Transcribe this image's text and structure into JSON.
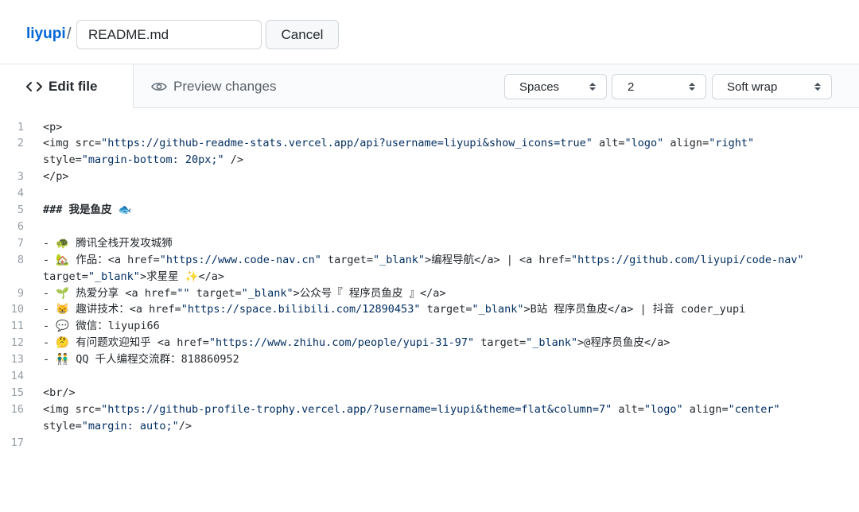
{
  "header": {
    "owner": "liyupi",
    "separator": "/",
    "filename": "README.md",
    "cancel_label": "Cancel"
  },
  "tabs": {
    "edit_label": "Edit file",
    "preview_label": "Preview changes"
  },
  "editor_options": {
    "indent_mode": "Spaces",
    "indent_size": "2",
    "wrap_mode": "Soft wrap"
  },
  "colors": {
    "link": "#0366d6",
    "string": "#032f62",
    "line_number": "#959da5"
  },
  "editor": {
    "line_numbers": [
      "1",
      "2",
      "3",
      "4",
      "5",
      "6",
      "7",
      "8",
      "9",
      "10",
      "11",
      "12",
      "13",
      "14",
      "15",
      "16",
      "17"
    ],
    "lines": [
      {
        "text": "<p>"
      },
      {
        "parts": [
          "<img src=",
          "\"https://github-readme-stats.vercel.app/api?username=liyupi&show_icons=true\"",
          " alt=",
          "\"logo\"",
          " align=",
          "\"right\""
        ]
      },
      {
        "parts": [
          "style=",
          "\"margin-bottom: 20px;\"",
          " />"
        ]
      },
      {
        "text": "</p>"
      },
      {
        "text": ""
      },
      {
        "text": "### 我是鱼皮 🐟"
      },
      {
        "text": ""
      },
      {
        "text": "- 🐢 腾讯全栈开发攻城狮"
      },
      {
        "parts": [
          "- 🏡 作品：<a href=",
          "\"https://www.code-nav.cn\"",
          " target=",
          "\"_blank\"",
          ">编程导航</a> | <a href=",
          "\"https://github.com/liyupi/code-nav\""
        ]
      },
      {
        "parts": [
          "target=",
          "\"_blank\"",
          ">求星星 ✨</a>"
        ]
      },
      {
        "parts": [
          "- 🌱 热爱分享 <a href=",
          "\"\"",
          " target=",
          "\"_blank\"",
          ">公众号『 程序员鱼皮 』</a>"
        ]
      },
      {
        "parts": [
          "- 😸 趣讲技术：<a href=",
          "\"https://space.bilibili.com/12890453\"",
          " target=",
          "\"_blank\"",
          ">B站 程序员鱼皮</a> | 抖音 coder_yupi"
        ]
      },
      {
        "text": "- 💬 微信：liyupi66"
      },
      {
        "parts": [
          "- 🤔 有问题欢迎知乎 <a href=",
          "\"https://www.zhihu.com/people/yupi-31-97\"",
          " target=",
          "\"_blank\"",
          ">@程序员鱼皮</a>"
        ]
      },
      {
        "text": "- 👬 QQ 千人编程交流群：818860952"
      },
      {
        "text": ""
      },
      {
        "text": "<br/>"
      },
      {
        "parts": [
          "<img src=",
          "\"https://github-profile-trophy.vercel.app/?username=liyupi&theme=flat&column=7\"",
          " alt=",
          "\"logo\"",
          " align=",
          "\"center\""
        ]
      },
      {
        "parts": [
          "style=",
          "\"margin: auto;\"",
          "/>"
        ]
      },
      {
        "text": ""
      }
    ]
  }
}
